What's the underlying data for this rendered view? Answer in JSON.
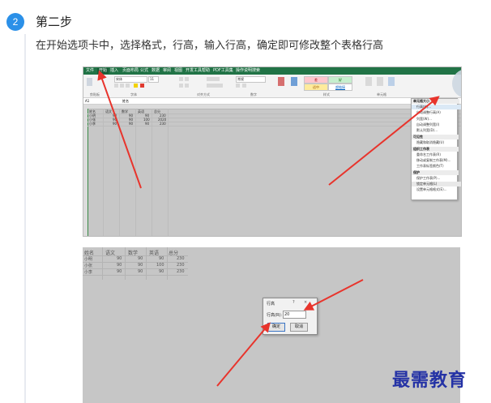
{
  "step": {
    "number": "2",
    "title": "第二步",
    "description": "在开始选项卡中，选择格式，行高，输入行高，确定即可修改整个表格行高"
  },
  "excel": {
    "tabs": [
      "文件",
      "开始",
      "插入",
      "页面布局",
      "公式",
      "数据",
      "审阅",
      "视图",
      "开发工具",
      "帮助",
      "PDF工具集",
      "操作说明搜索"
    ],
    "font_name": "宋体",
    "font_size": "11",
    "number_format": "常规",
    "name_box": "A1",
    "formula_value": "姓名",
    "group_labels": [
      "剪贴板",
      "字体",
      "对齐方式",
      "数字",
      "样式",
      "单元格"
    ],
    "styles": [
      {
        "label": "差",
        "bg": "#ffc7ce",
        "fg": "#9c0006"
      },
      {
        "label": "好",
        "bg": "#c6efce",
        "fg": "#006100"
      },
      {
        "label": "适中",
        "bg": "#ffeb9c",
        "fg": "#9c5700"
      },
      {
        "label": "超链接",
        "bg": "#ffffff",
        "fg": "#0563c1"
      }
    ],
    "table_headers": [
      "姓名",
      "语文",
      "数学",
      "英语",
      "总分"
    ],
    "table_rows": [
      [
        "小明",
        "90",
        "90",
        "90",
        "230"
      ],
      [
        "小张",
        "90",
        "90",
        "100",
        "2020"
      ],
      [
        "小李",
        "90",
        "90",
        "90",
        "230"
      ]
    ],
    "format_menu": {
      "sections": [
        {
          "heading": "单元格大小",
          "items": [
            "行高(H)...",
            "自动调整行高(A)",
            "列宽(W)...",
            "自动调整列宽(I)",
            "默认列宽(D)..."
          ]
        },
        {
          "heading": "可见性",
          "items": [
            "隐藏和取消隐藏(U)"
          ]
        },
        {
          "heading": "组织工作表",
          "items": [
            "重命名工作表(R)",
            "移动或复制工作表(M)...",
            "工作表标签颜色(T)"
          ]
        },
        {
          "heading": "保护",
          "items": [
            "保护工作表(P)...",
            "锁定单元格(L)",
            "设置单元格格式(E)..."
          ]
        }
      ]
    }
  },
  "dialog_shot": {
    "table_headers": [
      "姓名",
      "语文",
      "数学",
      "英语",
      "总分"
    ],
    "table_rows": [
      [
        "小明",
        "90",
        "90",
        "90",
        "230"
      ],
      [
        "小张",
        "90",
        "90",
        "100",
        "230"
      ],
      [
        "小李",
        "90",
        "90",
        "90",
        "230"
      ]
    ],
    "dialog": {
      "title": "行高",
      "help": "?",
      "close": "×",
      "label": "行高(R):",
      "value": "20",
      "ok": "确定",
      "cancel": "取消"
    }
  },
  "watermark": "最需教育",
  "colors": {
    "accent": "#2b90e8",
    "excel_green": "#217346",
    "arrow_red": "#e8342c",
    "watermark": "#2432a5"
  }
}
